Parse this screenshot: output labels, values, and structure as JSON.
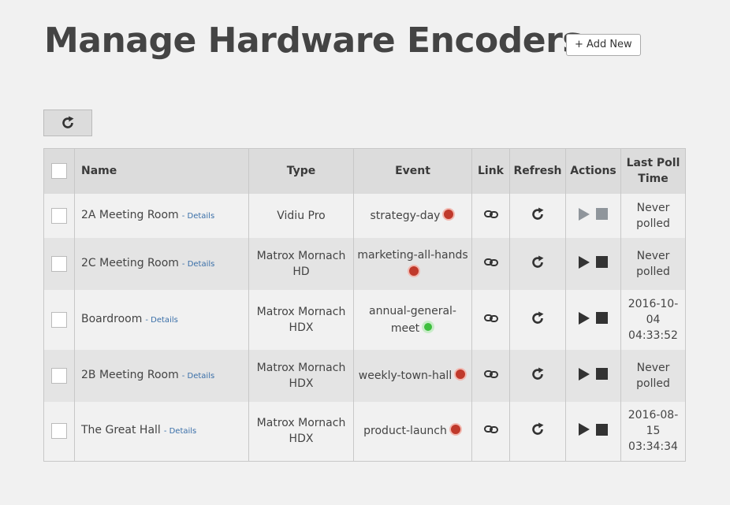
{
  "header": {
    "title": "Manage Hardware Encoders",
    "add_new_label": "+ Add New"
  },
  "toolbar": {
    "refresh_icon": "refresh-icon"
  },
  "table": {
    "columns": {
      "name": "Name",
      "type": "Type",
      "event": "Event",
      "link": "Link",
      "refresh": "Refresh",
      "actions": "Actions",
      "last_poll": "Last Poll Time"
    },
    "details_label": "- Details",
    "rows": [
      {
        "name": "2A Meeting Room",
        "type": "Vidiu Pro",
        "event": "strategy-day",
        "status": "red",
        "actions_enabled": false,
        "last_poll": "Never polled"
      },
      {
        "name": "2C Meeting Room",
        "type": "Matrox Mornach HD",
        "event": "marketing-all-hands",
        "status": "red",
        "actions_enabled": true,
        "last_poll": "Never polled"
      },
      {
        "name": "Boardroom",
        "type": "Matrox Mornach HDX",
        "event": "annual-general-meet",
        "status": "green",
        "actions_enabled": true,
        "last_poll": "2016-10-04 04:33:52"
      },
      {
        "name": "2B Meeting Room",
        "type": "Matrox Mornach HDX",
        "event": "weekly-town-hall",
        "status": "red",
        "actions_enabled": true,
        "last_poll": "Never polled"
      },
      {
        "name": "The Great Hall",
        "type": "Matrox Mornach HDX",
        "event": "product-launch",
        "status": "red",
        "actions_enabled": true,
        "last_poll": "2016-08-15 03:34:34"
      }
    ]
  },
  "colors": {
    "status_red": "#c0392b",
    "status_green": "#3ebf3e",
    "details_link": "#3a6fa8",
    "disabled_action": "#8f959b"
  }
}
